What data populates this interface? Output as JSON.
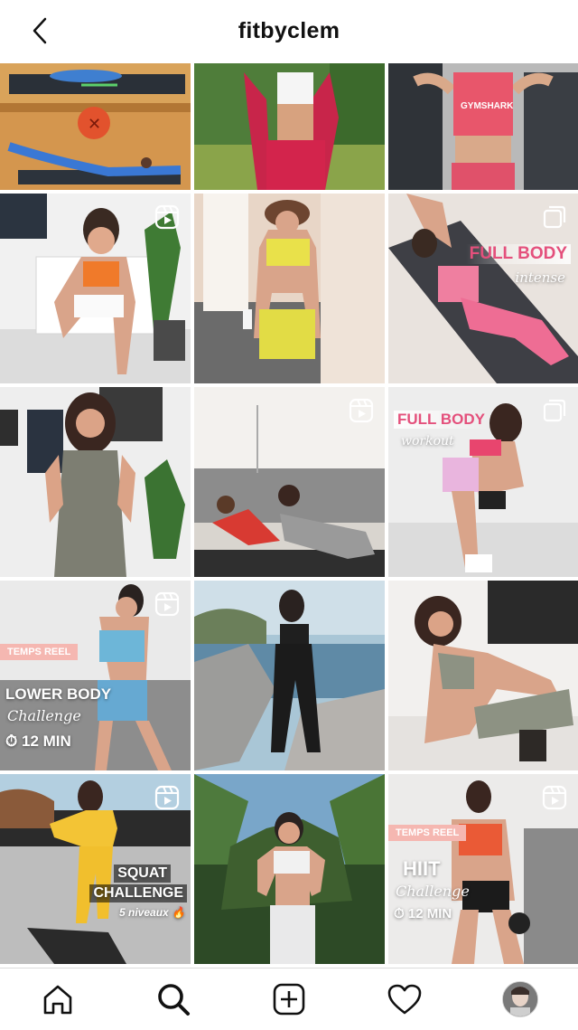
{
  "header": {
    "title": "fitbyclem",
    "back_icon": "chevron-left-icon"
  },
  "tiles": [
    {
      "id": 1,
      "kind": "photo"
    },
    {
      "id": 2,
      "kind": "photo"
    },
    {
      "id": 3,
      "kind": "photo",
      "shirt_text": "GYMSHARK"
    },
    {
      "id": 4,
      "kind": "reel"
    },
    {
      "id": 5,
      "kind": "photo"
    },
    {
      "id": 6,
      "kind": "carousel",
      "line1": "FULL BODY",
      "line2": "intense"
    },
    {
      "id": 7,
      "kind": "photo"
    },
    {
      "id": 8,
      "kind": "reel"
    },
    {
      "id": 9,
      "kind": "carousel",
      "line1": "FULL BODY",
      "line2": "workout"
    },
    {
      "id": 10,
      "kind": "reel",
      "tag": "TEMPS REEL",
      "line1": "LOWER BODY",
      "line2": "Challenge",
      "line3": "12 MIN"
    },
    {
      "id": 11,
      "kind": "photo"
    },
    {
      "id": 12,
      "kind": "photo"
    },
    {
      "id": 13,
      "kind": "reel",
      "line1": "SQUAT",
      "line2": "CHALLENGE",
      "line3": "5 niveaux"
    },
    {
      "id": 14,
      "kind": "photo"
    },
    {
      "id": 15,
      "kind": "reel",
      "tag": "TEMPS REEL",
      "line1": "HIIT",
      "line2": "Challenge",
      "line3": "12 MIN"
    }
  ],
  "tabbar": {
    "items": [
      "home-icon",
      "search-icon",
      "new-post-icon",
      "activity-heart-icon",
      "profile-avatar"
    ]
  }
}
